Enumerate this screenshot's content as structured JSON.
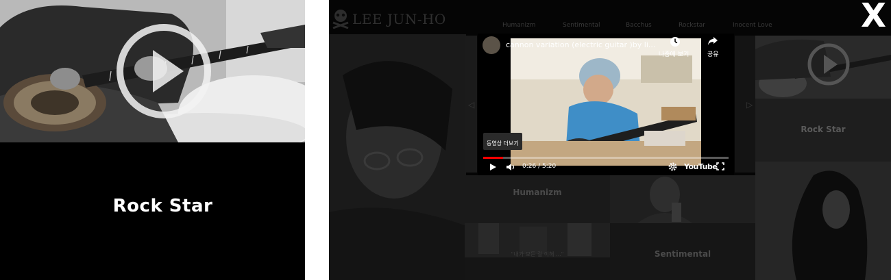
{
  "left_panel": {
    "caption": "Rock Star",
    "photo_icon": "play-circle-icon"
  },
  "site": {
    "logo_icon": "skull-crossbones-icon",
    "title": "LEE JUN-HO",
    "nav": [
      "Humanizm",
      "Sentimental",
      "Bacchus",
      "Rockstar",
      "Inocent Love"
    ]
  },
  "close_label": "X",
  "tiles": {
    "rock_star": "Rock Star",
    "humanizm": "Humanizm",
    "sentimental": "Sentimental",
    "quote": "\"내가 모든 걸 이해 ...\""
  },
  "video": {
    "title": "cannon variation (electric guitar )by li...",
    "watch_later_label": "나중에 보기",
    "share_label": "공유",
    "more_videos_label": "동영상 더보기",
    "time": "0:26 / 5:20",
    "progress": 0.08,
    "brand": "YouTube",
    "icons": {
      "play": "play-icon",
      "volume": "volume-icon",
      "settings": "gear-icon",
      "fullscreen": "fullscreen-icon",
      "clock": "clock-icon",
      "share": "share-arrow-icon"
    }
  },
  "colors": {
    "background": "#000000",
    "progress_red": "#ff0000",
    "caption_text": "#ffffff"
  }
}
